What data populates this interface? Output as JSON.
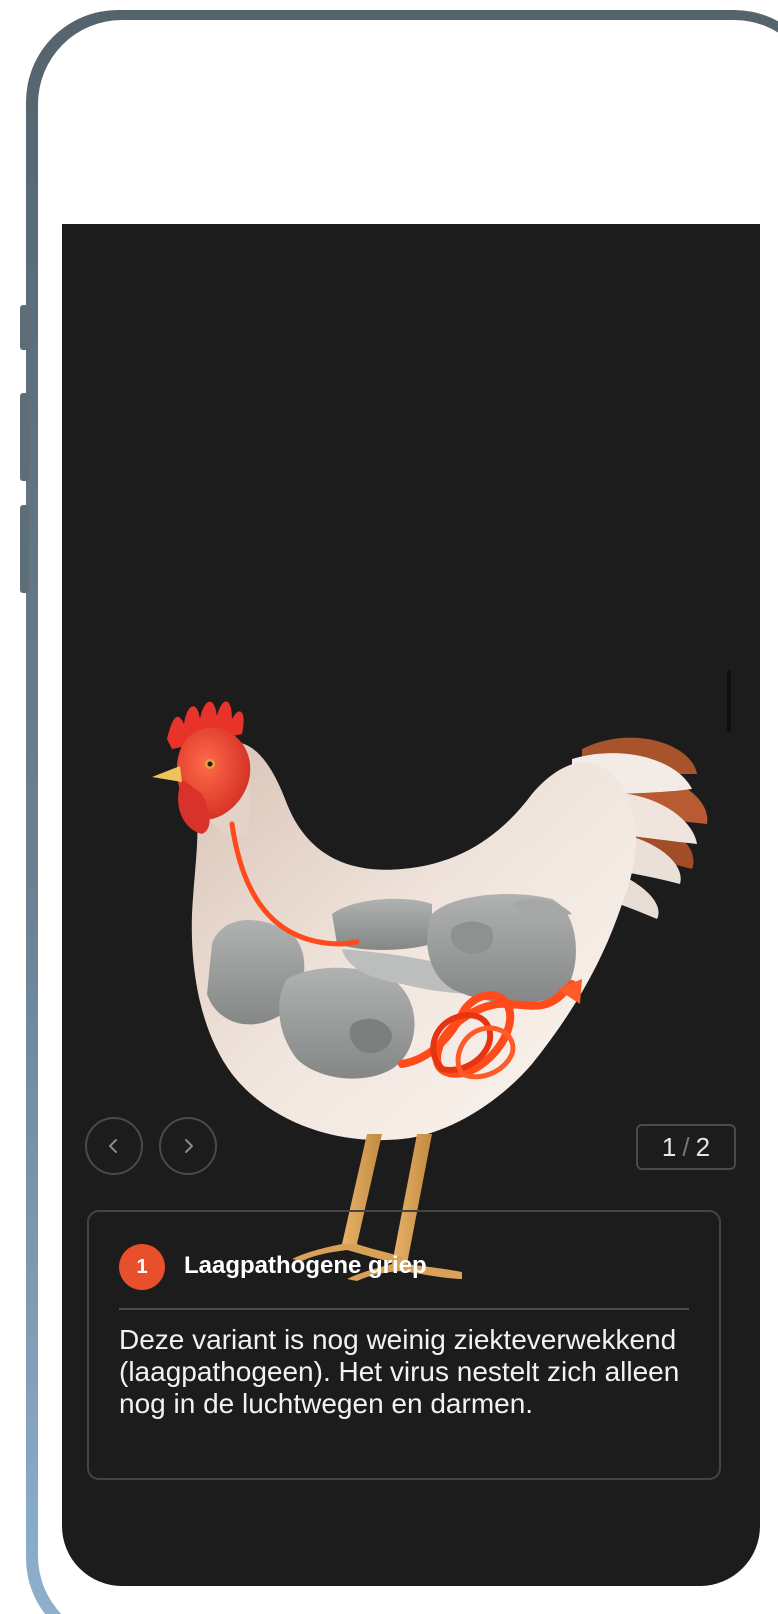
{
  "slide": {
    "current": "1",
    "separator": "/",
    "total": "2",
    "illustration_label": "chicken-illustration"
  },
  "navigation": {
    "prev_icon": "chevron-left-icon",
    "next_icon": "chevron-right-icon"
  },
  "card": {
    "badge": "1",
    "title": "Laagpathogene griep",
    "body": "Deze variant is nog weinig ziekteverwekkend (laagpathogeen). Het virus nestelt zich alleen nog in de luchtwegen en darmen."
  },
  "colors": {
    "screen_background": "#1c1c1c",
    "accent": "#e8502c",
    "highlight_organs": "#ff4a1c",
    "organs": "#9a9c9b",
    "frame": "#5d6e79"
  }
}
